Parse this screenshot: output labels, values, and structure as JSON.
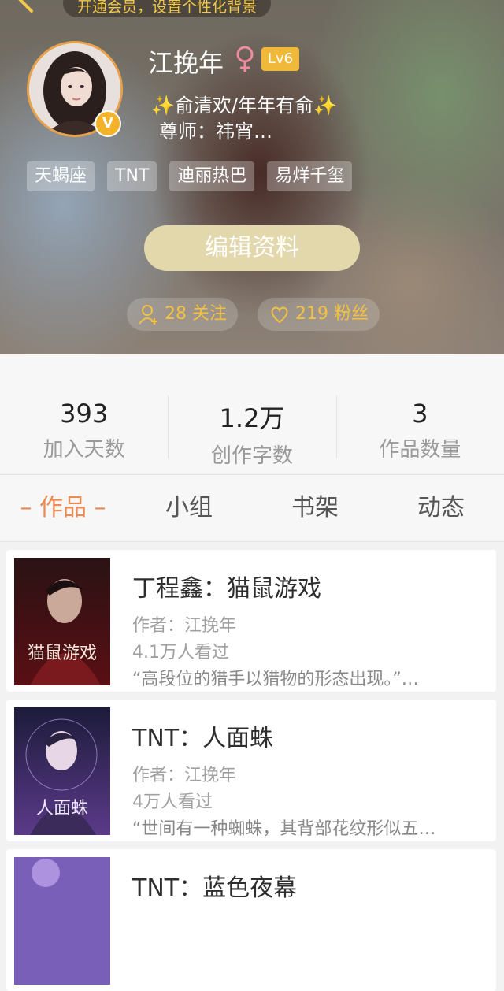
{
  "header": {
    "vip_banner": "开通会员，设置个性化背景",
    "username": "江挽年",
    "gender_symbol": "♀",
    "level": "Lv6",
    "motto_sparkle": "✨",
    "motto": "俞清欢/年年有俞",
    "mentor": "尊师：祎宵…",
    "tags": [
      "天蝎座",
      "TNT",
      "迪丽热巴",
      "易烊千玺"
    ],
    "edit_label": "编辑资料",
    "following": "28 关注",
    "followers": "219 粉丝",
    "vip_badge": "V"
  },
  "stats": [
    {
      "value": "393",
      "label": "加入天数"
    },
    {
      "value": "1.2万",
      "label": "创作字数"
    },
    {
      "value": "3",
      "label": "作品数量"
    }
  ],
  "tabs": [
    "– 作品 –",
    "小组",
    "书架",
    "动态"
  ],
  "works": [
    {
      "title": "丁程鑫：猫鼠游戏",
      "author": "作者：江挽年",
      "views": "4.1万人看过",
      "desc": "“高段位的猎手以猎物的形态出现。”…",
      "cover_text": "猫鼠游戏"
    },
    {
      "title": "TNT：人面蛛",
      "author": "作者：江挽年",
      "views": "4万人看过",
      "desc": "“世间有一种蜘蛛，其背部花纹形似五…",
      "cover_text": "人面蛛"
    },
    {
      "title": "TNT：蓝色夜幕",
      "author": "",
      "views": "",
      "desc": "",
      "cover_text": ""
    }
  ],
  "colors": {
    "accent": "#ec8a52",
    "gold": "#f2c142",
    "level_badge": "#f0b93a"
  }
}
